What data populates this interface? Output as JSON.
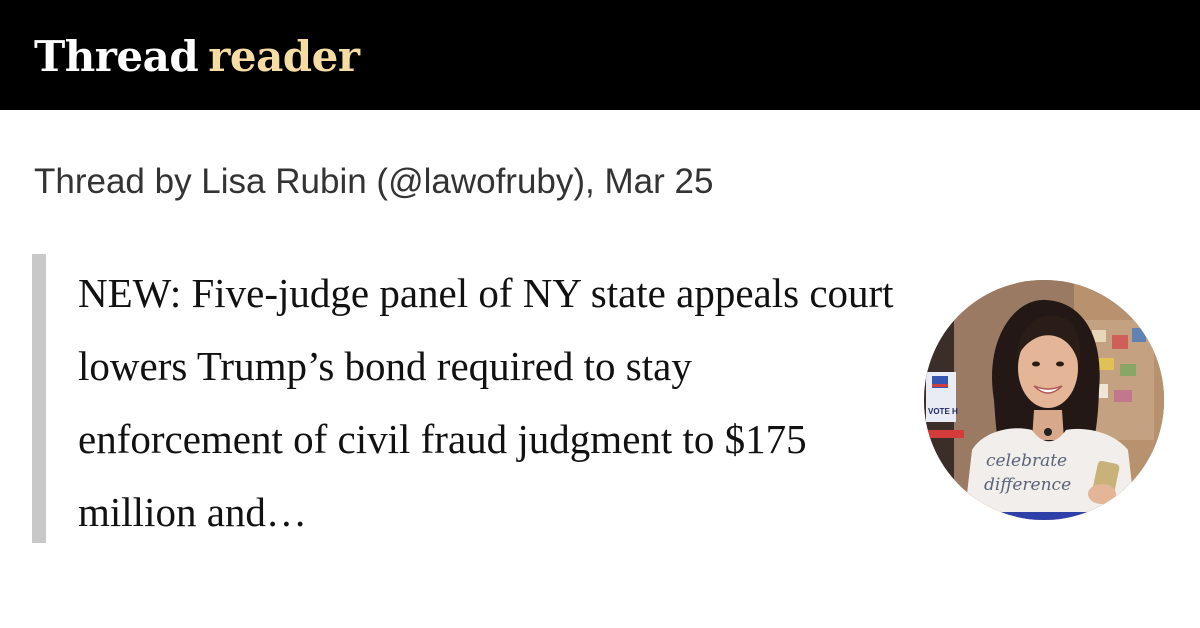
{
  "header": {
    "brand_thread": "Thread",
    "brand_reader": "reader",
    "background_color": "#000000",
    "reader_color": "#f5dca3"
  },
  "byline": {
    "text": "Thread by Lisa Rubin (@lawofruby), Mar 25"
  },
  "tweet": {
    "text": "NEW: Five-judge panel of NY state appeals court lowers Trump’s bond required to stay enforcement of civil fraud judgment to $175 million and…"
  },
  "avatar": {
    "shirt_text_line1": "celebrate",
    "shirt_text_line2": "difference",
    "sign_text": "VOTE H"
  }
}
